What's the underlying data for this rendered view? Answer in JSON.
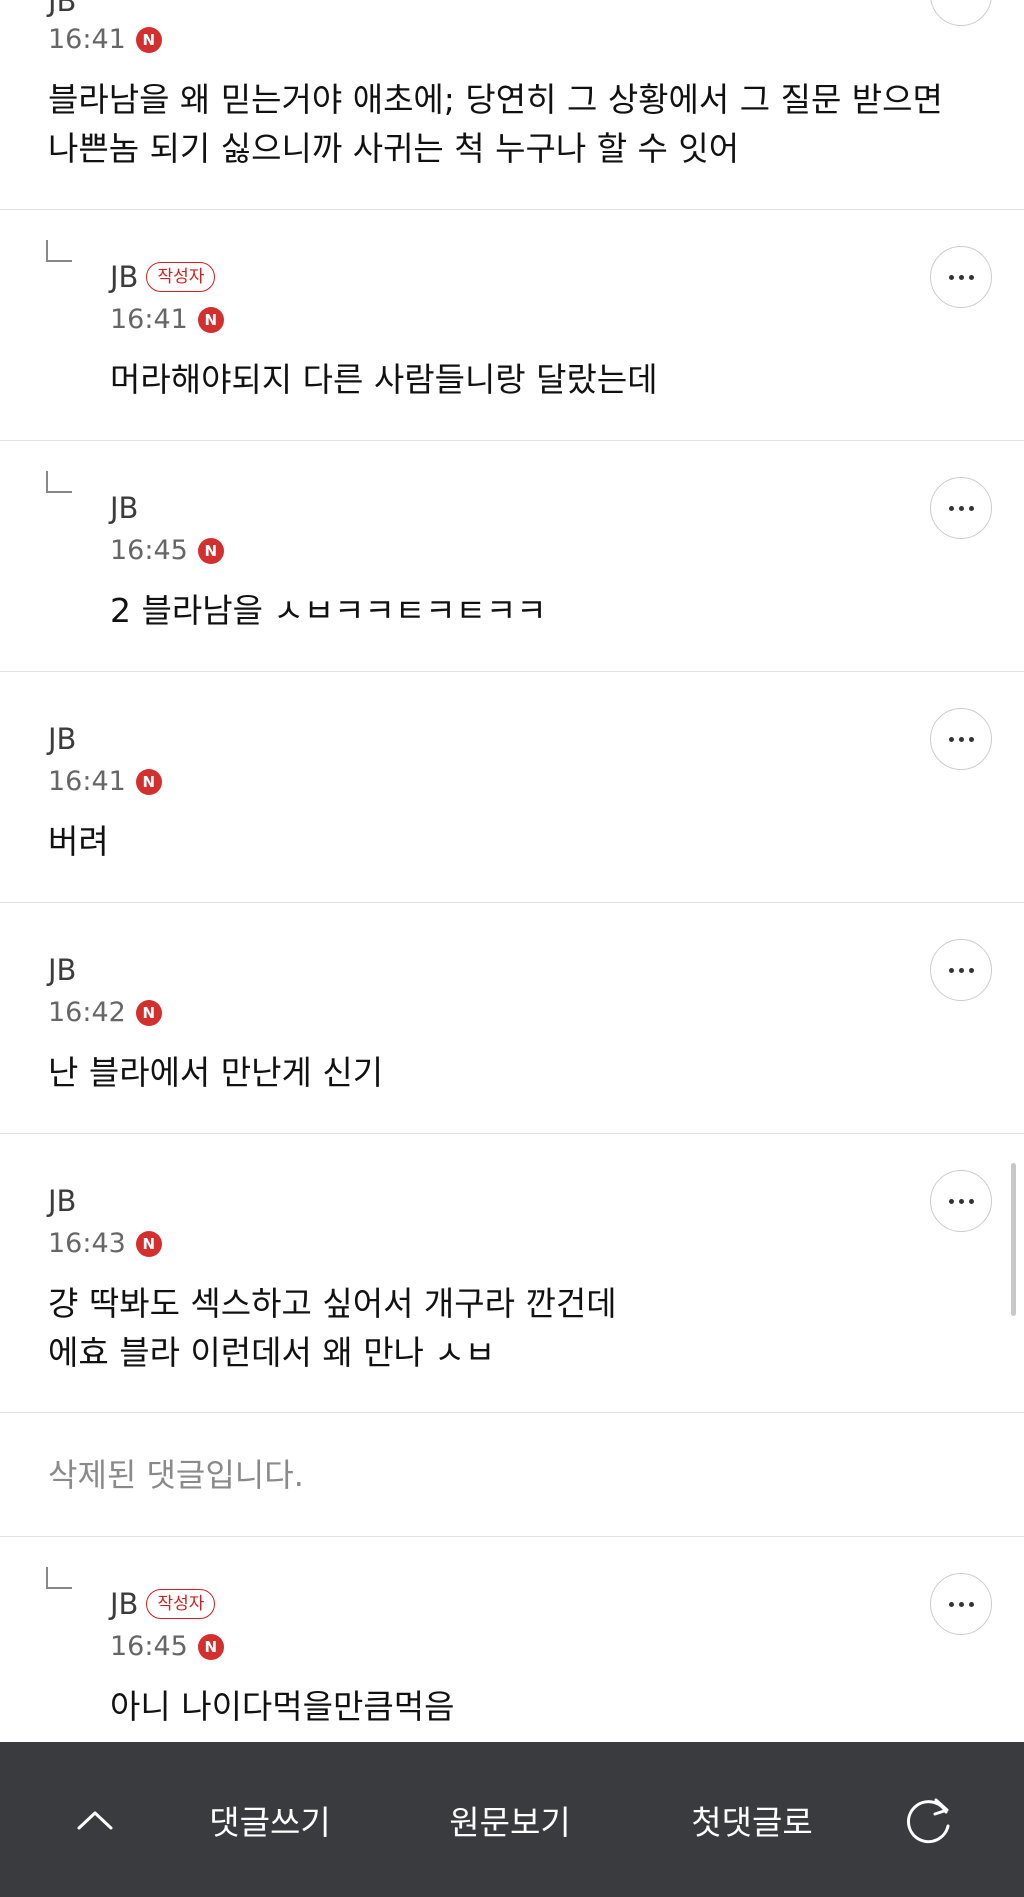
{
  "author_badge": "작성자",
  "deleted_comment_text": "삭제된 댓글입니다.",
  "comments": [
    {
      "author": "JB",
      "time": "16:41",
      "badge": "N",
      "text": "블라남을 왜 믿는거야 애초에; 당연히 그 상황에서 그 질문 받으면\n나쁜놈 되기 싫으니까 사귀는 척 누구나 할 수 잇어"
    },
    {
      "author": "JB",
      "is_writer": true,
      "time": "16:41",
      "badge": "N",
      "reply": true,
      "text": "머라해야되지 다른 사람들니랑 달랐는데"
    },
    {
      "author": "JB",
      "time": "16:45",
      "badge": "N",
      "reply": true,
      "text": "2 블라남을 ㅅㅂㅋㅋㅌㅋㅌㅋㅋ"
    },
    {
      "author": "JB",
      "time": "16:41",
      "badge": "N",
      "text": "버려"
    },
    {
      "author": "JB",
      "time": "16:42",
      "badge": "N",
      "text": "난 블라에서 만난게 신기"
    },
    {
      "author": "JB",
      "time": "16:43",
      "badge": "N",
      "text": "걍 딱봐도 섹스하고 싶어서 개구라 깐건데\n에효 블라 이런데서 왜 만나 ㅅㅂ"
    },
    {
      "author": "JB",
      "is_writer": true,
      "time": "16:45",
      "badge": "N",
      "reply": true,
      "text": "아니 나이다먹을만큼먹음"
    }
  ],
  "bottom_bar": {
    "up_icon": "chevron-up-icon",
    "write_comment": "댓글쓰기",
    "view_original": "원문보기",
    "first_comment": "첫댓글로",
    "refresh_icon": "refresh-icon"
  },
  "colors": {
    "new_badge": "#d32f2f",
    "writer_badge": "#d21f1f",
    "bottom_bar": "#3a3b3f",
    "divider": "#e2e2e2"
  }
}
